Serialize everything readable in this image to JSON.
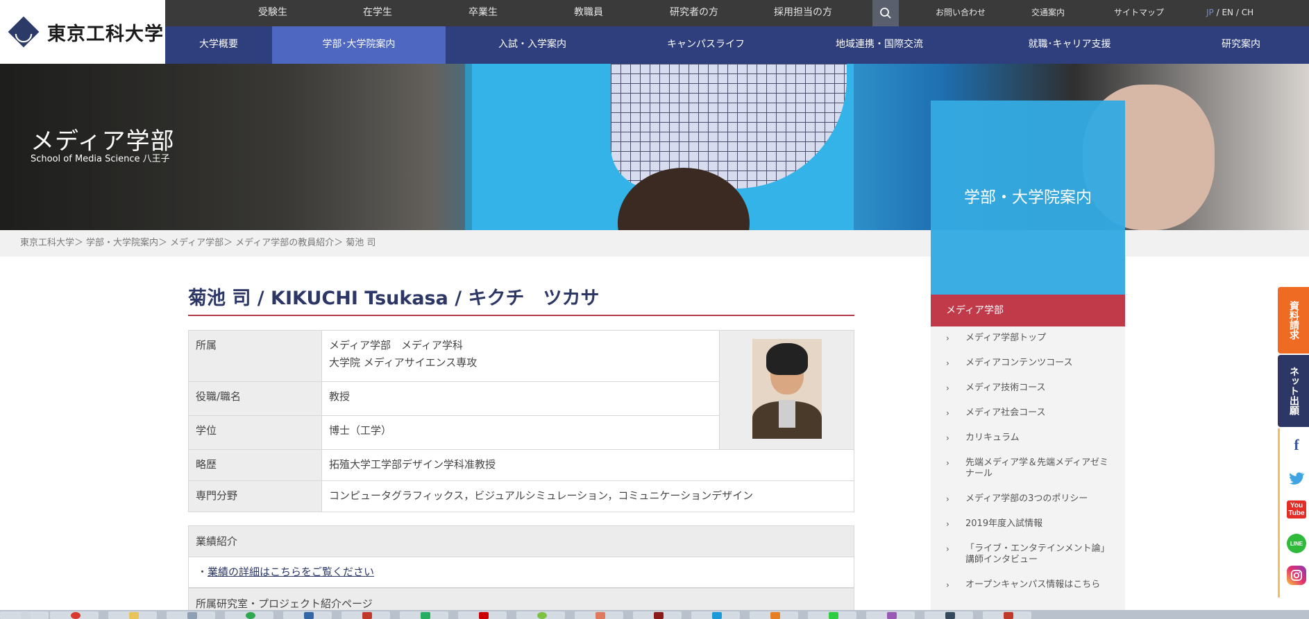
{
  "logo": {
    "text": "東京工科大学"
  },
  "topbar": {
    "items": [
      "受験生",
      "在学生",
      "卒業生",
      "教職員",
      "研究者の方",
      "採用担当の方"
    ],
    "utility": [
      "お問い合わせ",
      "交通案内",
      "サイトマップ"
    ],
    "lang": {
      "jp": "JP",
      "en": "/ EN",
      "ch": "/ CH"
    }
  },
  "nav": {
    "items": [
      "大学概要",
      "学部･大学院案内",
      "入試・入学案内",
      "キャンパスライフ",
      "地域連携・国際交流",
      "就職･キャリア支援",
      "研究案内"
    ],
    "active_index": 1
  },
  "hero": {
    "title": "メディア学部",
    "subtitle": "School of Media Science 八王子"
  },
  "breadcrumb": [
    "東京工科大学＞",
    "学部・大学院案内＞",
    "メディア学部＞",
    "メディア学部の教員紹介＞",
    "菊池 司"
  ],
  "side": {
    "header": "学部・大学院案内",
    "category": "メディア学部",
    "items": [
      "メディア学部トップ",
      "メディアコンテンツコース",
      "メディア技術コース",
      "メディア社会コース",
      "カリキュラム",
      "先端メディア学＆先端メディアゼミナール",
      "メディア学部の3つのポリシー",
      "2019年度入試情報",
      "「ライブ・エンタテインメント論」講師インタビュー",
      "オープンキャンパス情報はこちら"
    ]
  },
  "profile": {
    "name": "菊池 司 / KIKUCHI Tsukasa / キクチ　ツカサ",
    "rows": [
      {
        "label": "所属",
        "value_lines": [
          "メディア学部　メディア学科",
          "大学院 メディアサイエンス専攻"
        ]
      },
      {
        "label": "役職/職名",
        "value_lines": [
          "教授"
        ]
      },
      {
        "label": "学位",
        "value_lines": [
          "博士（工学）"
        ]
      },
      {
        "label": "略歴",
        "value_lines": [
          "拓殖大学工学部デザイン学科准教授"
        ]
      },
      {
        "label": "専門分野",
        "value_lines": [
          "コンピュータグラフィックス，ビジュアルシミュレーション，コミュニケーションデザイン"
        ]
      }
    ]
  },
  "achievements": {
    "header": "業績紹介",
    "bullet": "・",
    "link": "業績の詳細はこちらをご覧ください"
  },
  "lab": {
    "header": "所属研究室・プロジェクト紹介ページ"
  },
  "float": {
    "request": "資料請求",
    "net": "ネット出願"
  },
  "social": {
    "icons": [
      "facebook-icon",
      "twitter-icon",
      "youtube-icon",
      "line-icon",
      "instagram-icon"
    ],
    "youtube_label": "You Tube",
    "line_label": "LINE"
  },
  "colors": {
    "nav": "#2f3f7d",
    "nav_active": "#4e68c2",
    "accent_red": "#c03a4a",
    "side_blue": "#34aae1",
    "request_orange": "#ef6a22"
  }
}
